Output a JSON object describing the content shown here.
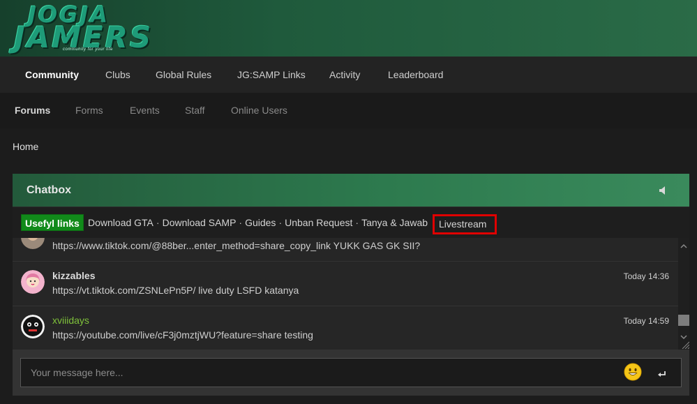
{
  "banner": {
    "logo_line1": "JOGJA",
    "logo_line2": "JAMERS",
    "logo_tagline": "community for your life"
  },
  "nav_primary": [
    {
      "label": "Community"
    },
    {
      "label": "Clubs"
    },
    {
      "label": "Global Rules"
    },
    {
      "label": "JG:SAMP Links"
    },
    {
      "label": "Activity"
    },
    {
      "label": "Leaderboard"
    }
  ],
  "nav_secondary": [
    {
      "label": "Forums"
    },
    {
      "label": "Forms"
    },
    {
      "label": "Events"
    },
    {
      "label": "Staff"
    },
    {
      "label": "Online Users"
    }
  ],
  "breadcrumb": {
    "home": "Home"
  },
  "chatbox": {
    "title": "Chatbox",
    "useful_links_label": "Usefyl links",
    "links": [
      "Download GTA",
      "Download SAMP",
      "Guides",
      "Unban Request",
      "Tanya & Jawab"
    ],
    "livestream_label": "Livestream",
    "separator": "·",
    "messages": [
      {
        "author": "",
        "time": "",
        "text": "https://www.tiktok.com/@88ber...enter_method=share_copy_link YUKK GAS GK SII?"
      },
      {
        "author": "kizzables",
        "time": "Today 14:36",
        "text": "https://vt.tiktok.com/ZSNLePn5P/ live duty LSFD katanya"
      },
      {
        "author": "xviiidays",
        "time": "Today 14:59",
        "text": "https://youtube.com/live/cF3j0mztjWU?feature=share testing"
      }
    ],
    "input": {
      "placeholder": "Your message here...",
      "value": ""
    }
  },
  "colors": {
    "accent_green": "#2d7a4e",
    "useful_badge": "#118a1a",
    "highlight_red": "#e00000",
    "author_green": "#7fc23b"
  },
  "icons": {
    "sound": "volume-icon",
    "emoji": "smiley-icon",
    "send": "enter-icon"
  }
}
